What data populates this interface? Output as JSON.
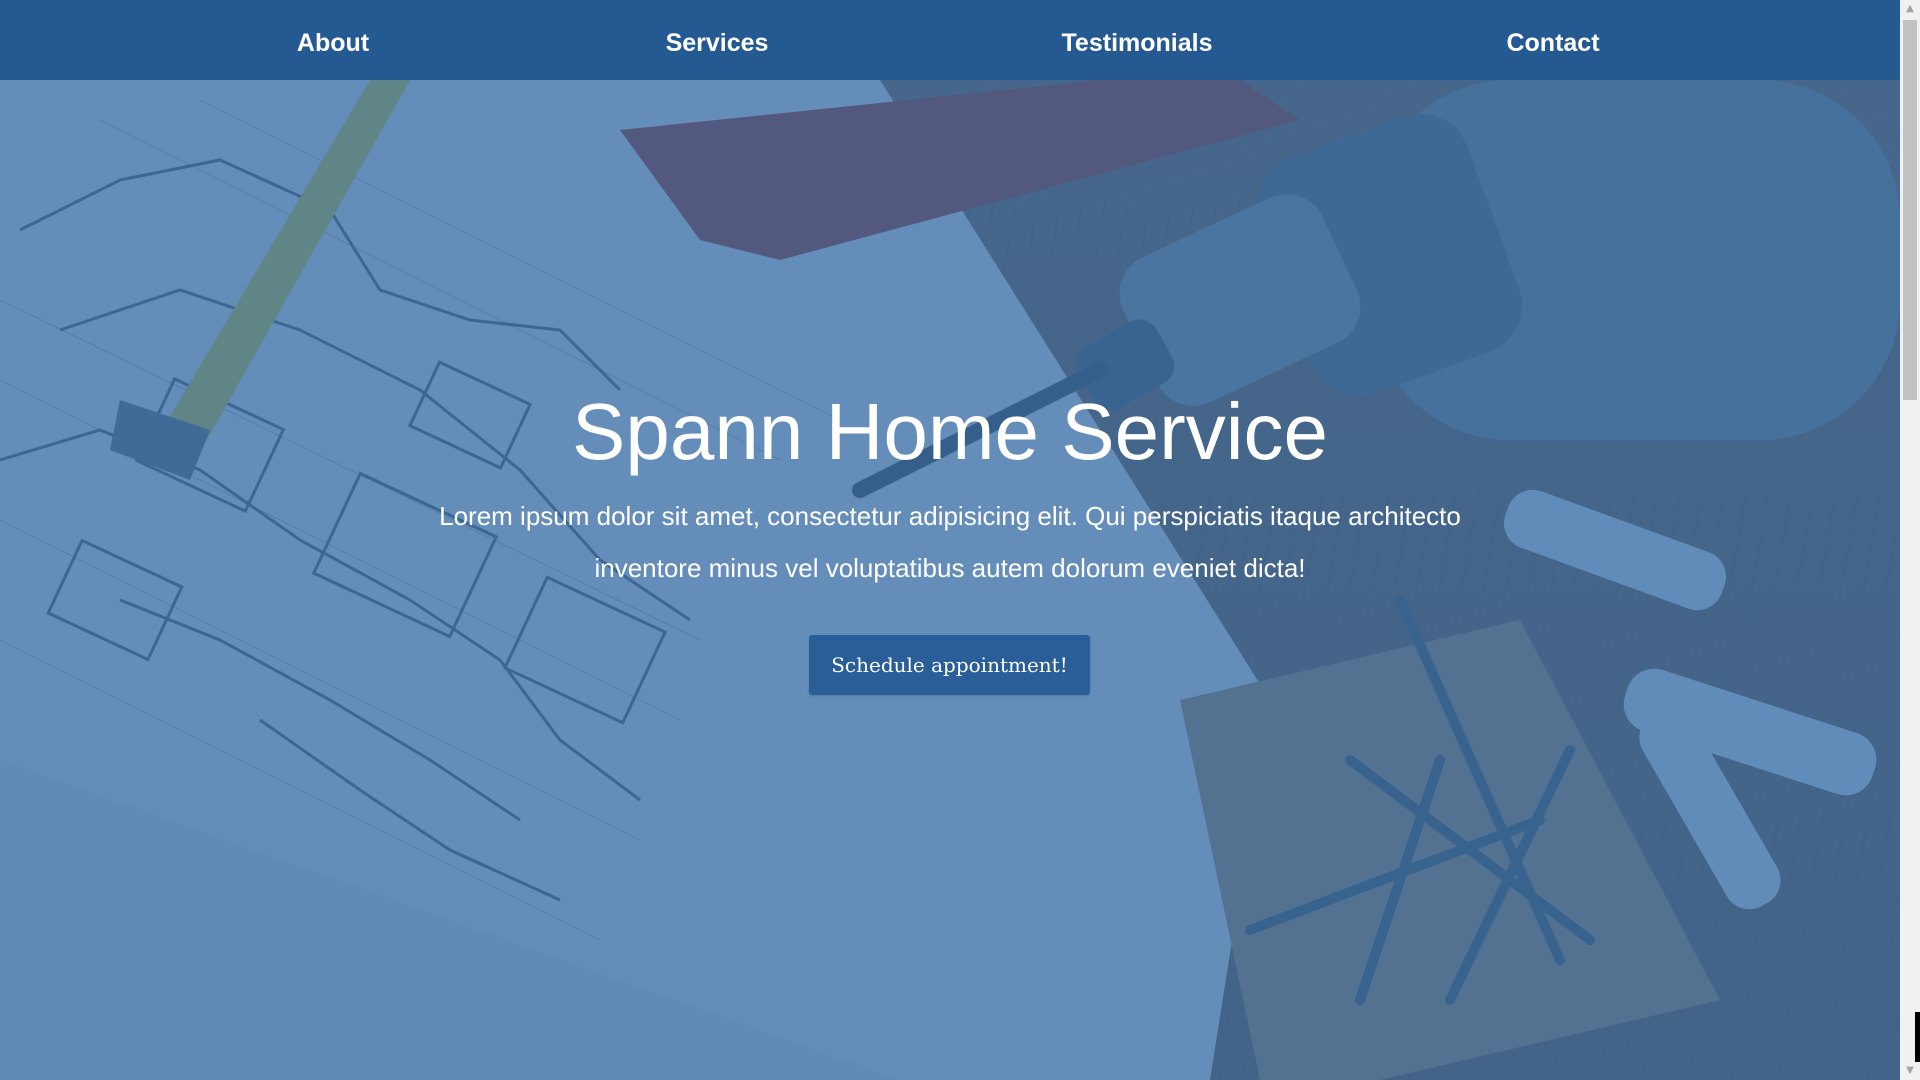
{
  "nav": {
    "items": [
      {
        "label": "About"
      },
      {
        "label": "Services"
      },
      {
        "label": "Testimonials"
      },
      {
        "label": "Contact"
      }
    ]
  },
  "hero": {
    "title": "Spann Home Service",
    "subtitle": "Lorem ipsum dolor sit amet, consectetur adipisicing elit. Qui perspiciatis itaque architecto inventore minus vel voluptatibus autem dolorum eveniet dicta!",
    "cta_label": "Schedule appointment!",
    "background_image": "blueprint, measuring tape, drill, screws and wall plugs on wooden table"
  },
  "colors": {
    "navbar": "#225892",
    "tint": "#2c66a4",
    "button": "#2a5e98",
    "text": "#ffffff"
  },
  "icons": {
    "scroll_up": "scroll-up-arrow-icon",
    "scroll_down": "scroll-down-arrow-icon"
  }
}
